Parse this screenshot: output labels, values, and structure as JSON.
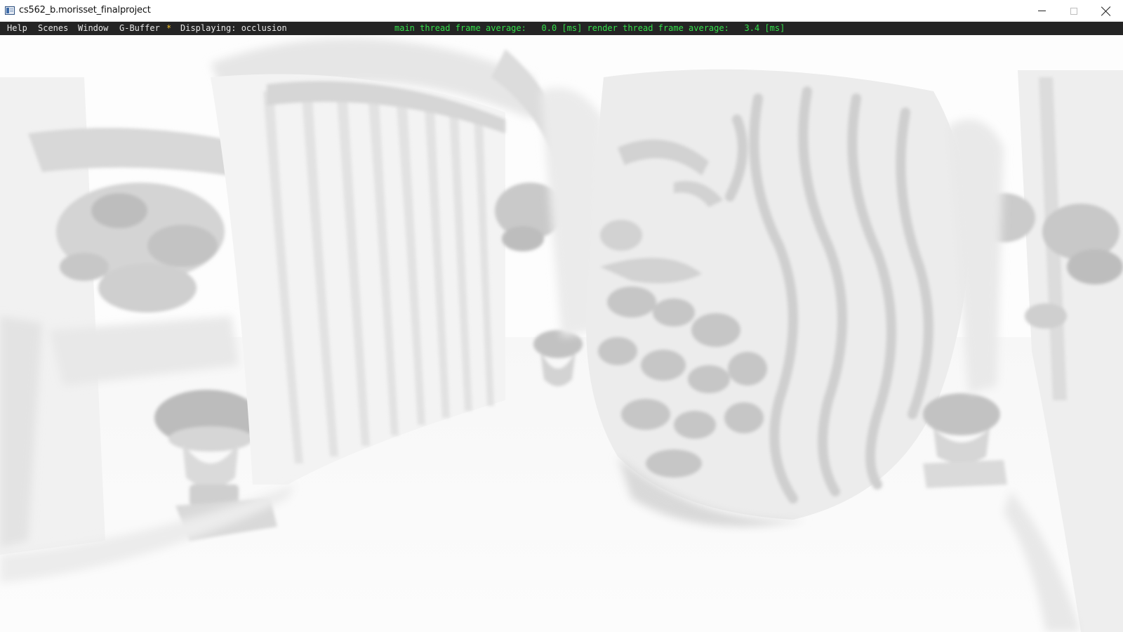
{
  "window": {
    "title": "cs562_b.morisset_finalproject"
  },
  "menu": {
    "items": [
      "Help",
      "Scenes",
      "Window",
      "G-Buffer"
    ],
    "marker": "*",
    "display_status": "Displaying: occlusion",
    "perf_text": "main thread frame average:   0.0 [ms] render thread frame average:   3.4 [ms]"
  },
  "colors": {
    "menu_bg": "#242424",
    "menu_text": "#e8e8e8",
    "marker": "#f2c231",
    "perf": "#33e04a"
  },
  "icons": {
    "app": "app-window-icon",
    "minimize": "minimize-icon",
    "maximize": "maximize-icon",
    "close": "close-icon"
  }
}
